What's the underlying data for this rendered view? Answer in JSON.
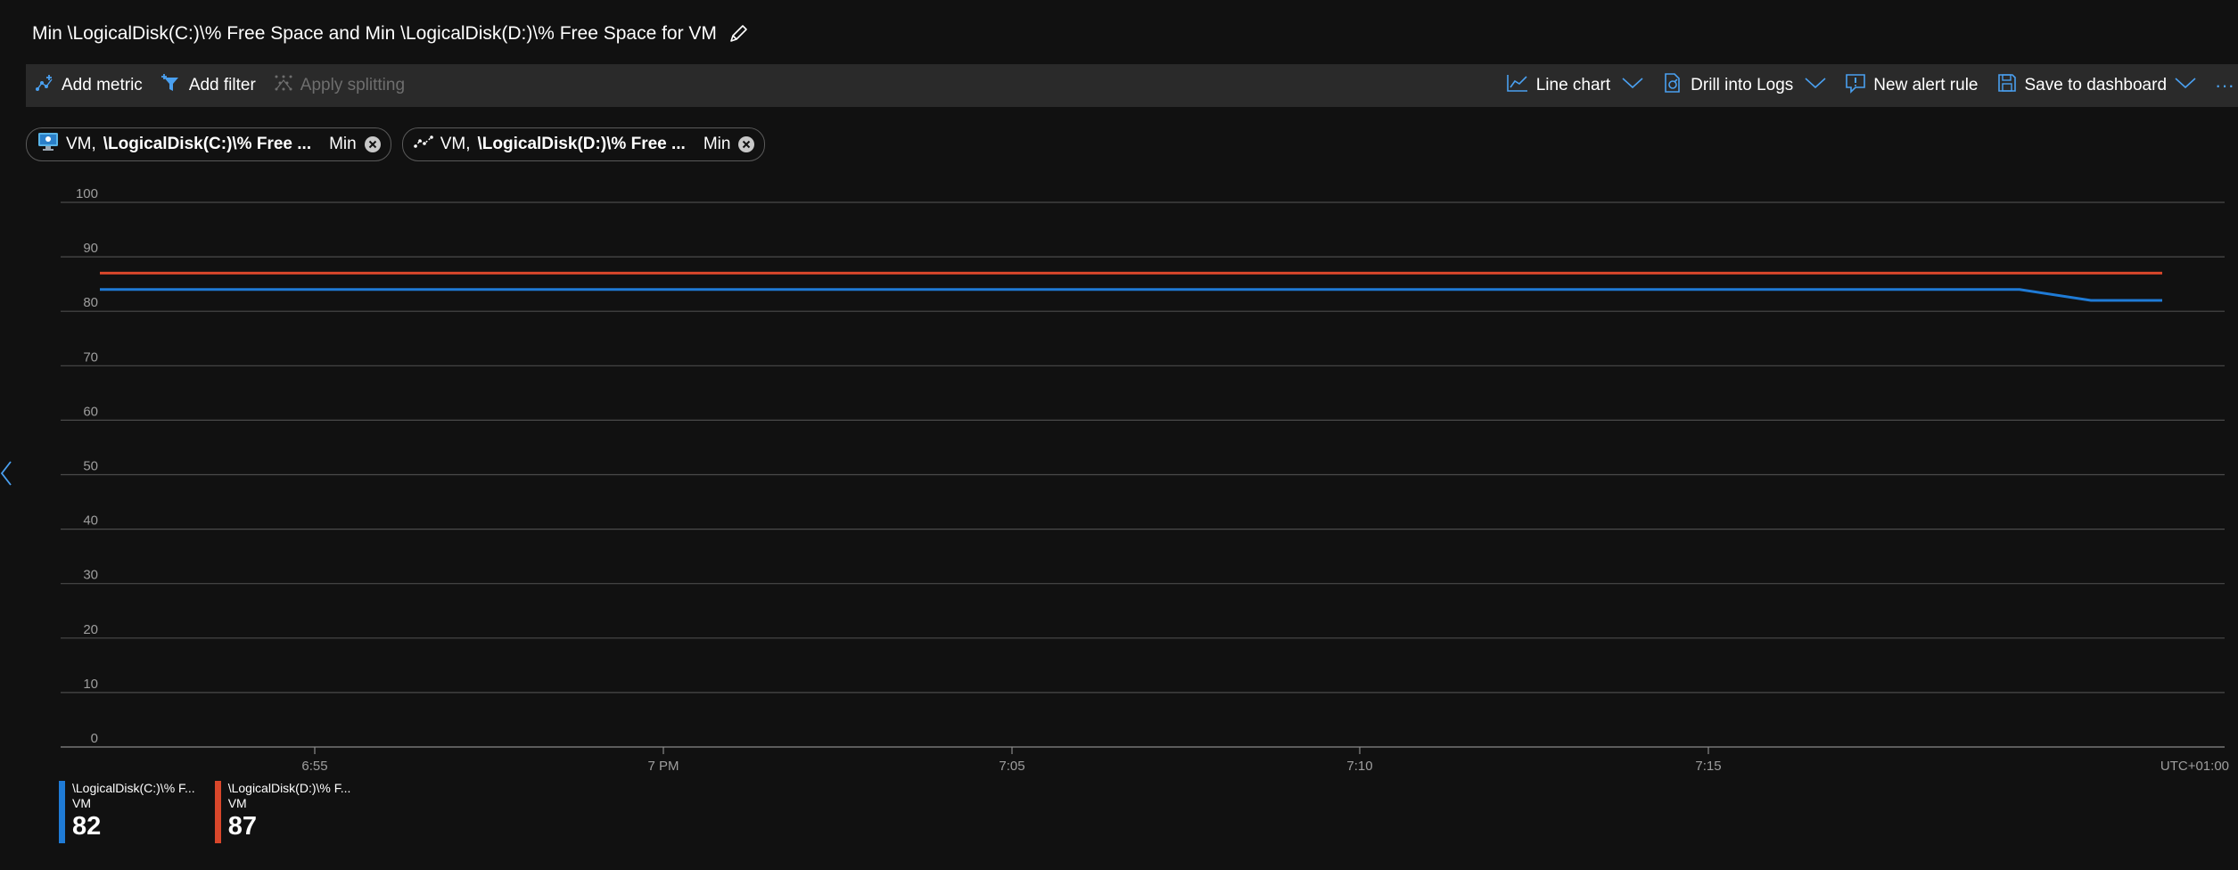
{
  "title": "Min \\LogicalDisk(C:)\\% Free Space and Min \\LogicalDisk(D:)\\% Free Space for VM",
  "toolbar": {
    "add_metric": "Add metric",
    "add_filter": "Add filter",
    "apply_splitting": "Apply splitting",
    "line_chart": "Line chart",
    "drill_into_logs": "Drill into Logs",
    "new_alert_rule": "New alert rule",
    "save_to_dashboard": "Save to dashboard",
    "more": "···"
  },
  "pills": [
    {
      "resource": "VM,",
      "metric": "\\LogicalDisk(C:)\\% Free ...",
      "aggregation": "Min",
      "icon": "vm-monitor-icon"
    },
    {
      "resource": "VM,",
      "metric": "\\LogicalDisk(D:)\\% Free ...",
      "aggregation": "Min",
      "icon": "metric-line-icon"
    }
  ],
  "legend": [
    {
      "name": "\\LogicalDisk(C:)\\% F...",
      "resource": "VM",
      "value": "82",
      "color": "#1f7bd6"
    },
    {
      "name": "\\LogicalDisk(D:)\\% F...",
      "resource": "VM",
      "value": "87",
      "color": "#d9472b"
    }
  ],
  "colors": {
    "background": "#111111",
    "toolbar": "#2a2a2a",
    "accent": "#4aa0f0",
    "series_c": "#1f7bd6",
    "series_d": "#d9472b"
  },
  "chart_data": {
    "type": "line",
    "title": "",
    "ylim": [
      0,
      100
    ],
    "yticks": [
      "0",
      "10",
      "20",
      "30",
      "40",
      "50",
      "60",
      "70",
      "80",
      "90",
      "100"
    ],
    "xticks": [
      "6:55",
      "7 PM",
      "7:05",
      "7:10",
      "7:15"
    ],
    "timezone_label": "UTC+01:00",
    "grid": true,
    "legend_position": "bottom-left",
    "x_unit": "minutes",
    "x_range": [
      6.84,
      7.35
    ],
    "x": [
      6.84,
      7.325,
      7.345,
      7.365
    ],
    "series": [
      {
        "name": "\\LogicalDisk(C:)\\% F...",
        "values": [
          84,
          84,
          82,
          82
        ]
      },
      {
        "name": "\\LogicalDisk(D:)\\% F...",
        "values": [
          87,
          87,
          87,
          87
        ]
      }
    ]
  }
}
